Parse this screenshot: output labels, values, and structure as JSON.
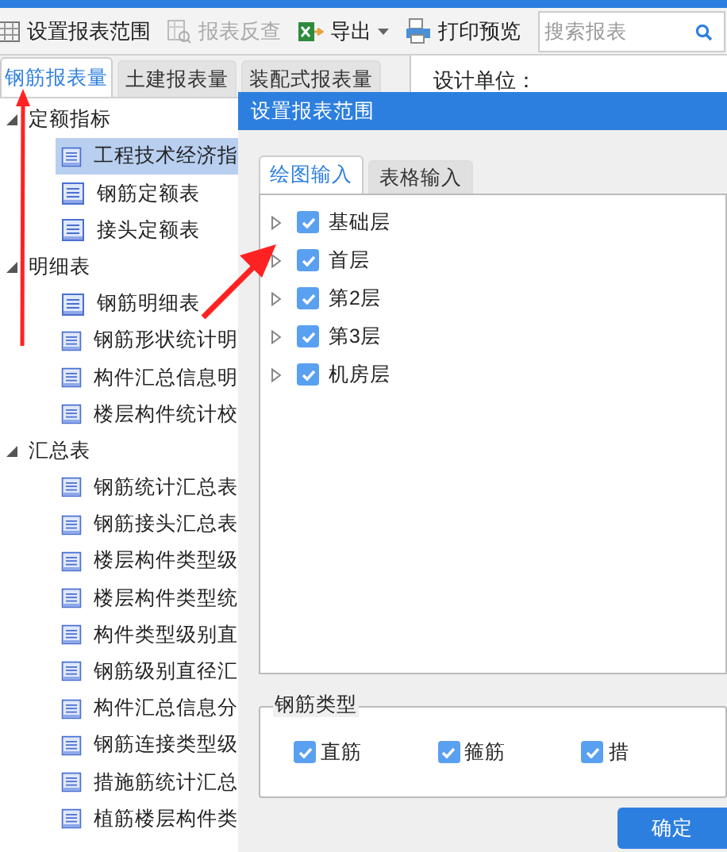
{
  "toolbar": [
    {
      "kind": "setup",
      "label": "设置报表范围",
      "disabled": false
    },
    {
      "kind": "lookup",
      "label": "报表反查",
      "disabled": true
    },
    {
      "kind": "export",
      "label": "导出",
      "disabled": false
    },
    {
      "kind": "print",
      "label": "打印预览",
      "disabled": false
    }
  ],
  "search": {
    "placeholder": "搜索报表"
  },
  "tabs": [
    {
      "label": "钢筋报表量",
      "selected": true
    },
    {
      "label": "土建报表量",
      "selected": false
    },
    {
      "label": "装配式报表量",
      "selected": false
    }
  ],
  "report_header": "设计单位：",
  "tree": [
    {
      "label": "定额指标",
      "expanded": true,
      "children": [
        {
          "label": "工程技术经济指",
          "selected": true
        },
        {
          "label": "钢筋定额表",
          "selected": false
        },
        {
          "label": "接头定额表",
          "selected": false
        }
      ]
    },
    {
      "label": "明细表",
      "expanded": true,
      "children": [
        {
          "label": "钢筋明细表",
          "selected": false
        },
        {
          "label": "钢筋形状统计明",
          "selected": false
        },
        {
          "label": "构件汇总信息明",
          "selected": false
        },
        {
          "label": "楼层构件统计校",
          "selected": false
        }
      ]
    },
    {
      "label": "汇总表",
      "expanded": true,
      "children": [
        {
          "label": "钢筋统计汇总表",
          "selected": false
        },
        {
          "label": "钢筋接头汇总表",
          "selected": false
        },
        {
          "label": "楼层构件类型级",
          "selected": false
        },
        {
          "label": "楼层构件类型统",
          "selected": false
        },
        {
          "label": "构件类型级别直",
          "selected": false
        },
        {
          "label": "钢筋级别直径汇",
          "selected": false
        },
        {
          "label": "构件汇总信息分",
          "selected": false
        },
        {
          "label": "钢筋连接类型级",
          "selected": false
        },
        {
          "label": "措施筋统计汇总",
          "selected": false
        },
        {
          "label": "植筋楼层构件类",
          "selected": false
        }
      ]
    }
  ],
  "dialog": {
    "title": "设置报表范围",
    "tabs": [
      {
        "label": "绘图输入",
        "selected": true
      },
      {
        "label": "表格输入",
        "selected": false
      }
    ],
    "floors": [
      {
        "label": "基础层",
        "expanded": false,
        "checked": true
      },
      {
        "label": "首层",
        "expanded": false,
        "checked": true
      },
      {
        "label": "第2层",
        "expanded": false,
        "checked": true
      },
      {
        "label": "第3层",
        "expanded": false,
        "checked": true
      },
      {
        "label": "机房层",
        "expanded": false,
        "checked": true
      }
    ],
    "rebar_types": {
      "title": "钢筋类型",
      "options": [
        {
          "label": "直筋",
          "checked": true
        },
        {
          "label": "箍筋",
          "checked": true
        },
        {
          "label": "措",
          "checked": true
        }
      ]
    },
    "ok_button": "确定"
  }
}
